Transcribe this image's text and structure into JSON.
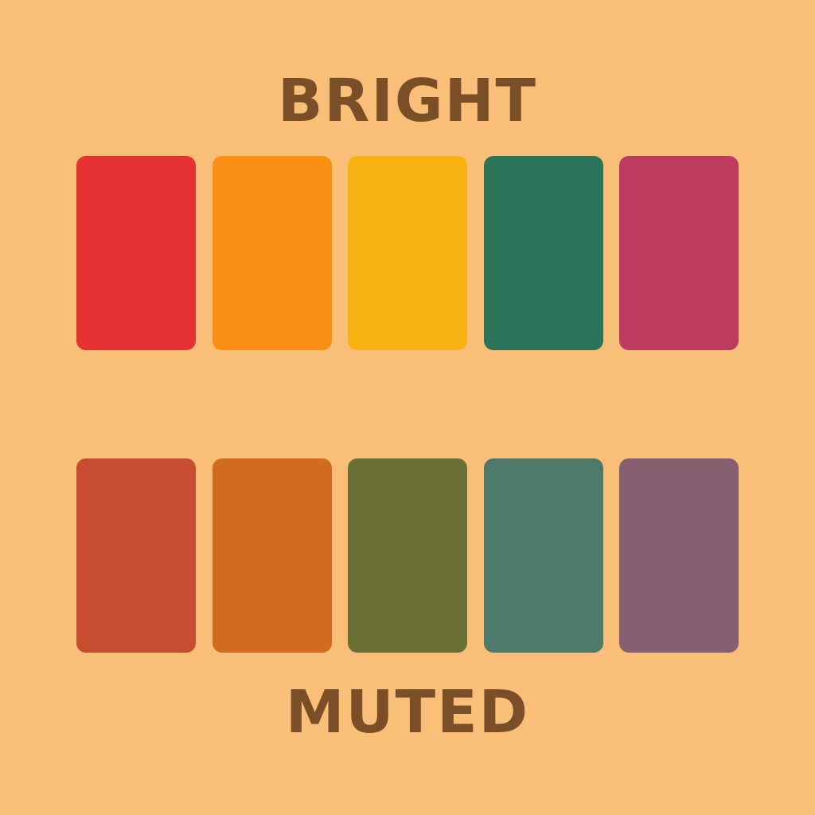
{
  "palette": {
    "background": "#f9be78",
    "text_color": "#7a4e26"
  },
  "bright": {
    "label": "BRIGHT",
    "swatches": [
      "#e63232",
      "#fb8f14",
      "#f8b312",
      "#2b7359",
      "#bd3b5e"
    ]
  },
  "muted": {
    "label": "MUTED",
    "swatches": [
      "#c84c30",
      "#d06b20",
      "#6b7035",
      "#4d7a6b",
      "#875f70"
    ]
  }
}
